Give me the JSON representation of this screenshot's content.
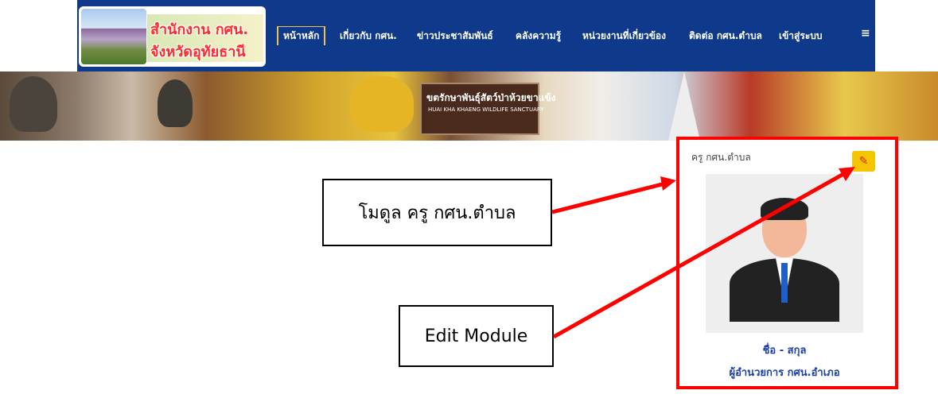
{
  "logo": {
    "line1": "สำนักงาน กศน.",
    "line2": "จังหวัดอุทัยธานี"
  },
  "nav": {
    "items": [
      "หน้าหลัก",
      "เกี่ยวกับ กศน.",
      "ข่าวประชาสัมพันธ์",
      "คลังความรู้",
      "หน่วยงานที่เกี่ยวข้อง",
      "ติดต่อ กศน.ตำบล",
      "เข้าสู่ระบบ"
    ],
    "menu_icon": "≡"
  },
  "banner": {
    "sign_text": "ขตรักษาพันธุ์สัตว์ป่าห้วยขาแข้ง",
    "sign_sub": "HUAI KHA KHAENG WILDLIFE SANCTUARY"
  },
  "module": {
    "title": "ครู กศน.ตำบล",
    "edit_icon": "edit-icon",
    "name": "ชื่อ - สกุล",
    "role": "ผู้อำนวยการ กศน.อำเภอ"
  },
  "callouts": {
    "module_label": "โมดูล ครู กศน.ตำบล",
    "edit_label": "Edit Module"
  },
  "colors": {
    "navbar": "#0f3a8c",
    "highlight": "#ff0000",
    "edit_button": "#f5c500",
    "link_text": "#1a3fa8"
  }
}
